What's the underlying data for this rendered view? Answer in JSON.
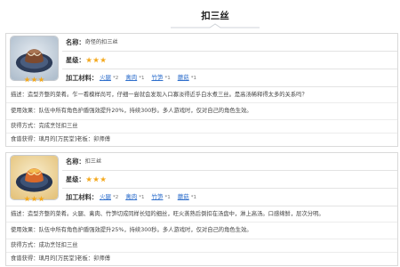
{
  "page": {
    "title": "扣三丝"
  },
  "colors": {
    "link": "#2f6fcc",
    "star": "#f4a81c",
    "text": "#3a3a3a",
    "border": "#dadada"
  },
  "cards": [
    {
      "icon": {
        "name": "dish-icon",
        "bg_light": "#e6ecf2",
        "bg_dark": "#aebdcc",
        "plate": "#2d3c58",
        "plate_inner": "#4a5d7e",
        "food": "#7e4a2e",
        "food_top": "#a87452",
        "topping": "#eee0c6"
      },
      "name_label": "名称：",
      "name": "奇怪的扣三丝",
      "star_label": "星级：",
      "stars": 3,
      "materials_label": "加工材料：",
      "materials": [
        {
          "name": "火腿",
          "count": "*2"
        },
        {
          "name": "禽肉",
          "count": "*1"
        },
        {
          "name": "竹笋",
          "count": "*1"
        },
        {
          "name": "蘑菇",
          "count": "*1"
        }
      ],
      "description_label": "描述：",
      "description": "造型齐整的菜肴。乍一看模样尚可，仔细一尝就会发现入口寡淡得近乎白水煮三丝。是高汤稀释得太多的关系吗？",
      "effect_label": "使用效果：",
      "effect": "队伍中所有角色护盾强效提升20%，持续300秒。多人游戏时，仅对自己的角色生效。",
      "obtain_label": "获得方式：",
      "obtain": "完成烹饪扣三丝",
      "recipe_label": "食谱获得：",
      "recipe": "璃月的[万民堂]老板：卯师傅"
    },
    {
      "icon": {
        "name": "dish-icon",
        "bg_light": "#f8eccb",
        "bg_dark": "#e4c27a",
        "plate": "#263552",
        "plate_inner": "#3d5275",
        "food": "#d9692a",
        "food_top": "#f2b94e",
        "topping": "#fbe6a6"
      },
      "name_label": "名称：",
      "name": "扣三丝",
      "star_label": "星级：",
      "stars": 3,
      "materials_label": "加工材料：",
      "materials": [
        {
          "name": "火腿",
          "count": "*2"
        },
        {
          "name": "禽肉",
          "count": "*1"
        },
        {
          "name": "竹笋",
          "count": "*1"
        },
        {
          "name": "蘑菇",
          "count": "*1"
        }
      ],
      "description_label": "描述：",
      "description": "造型齐整的菜肴。火腿、禽肉、竹笋切成同样长短的细丝，旺火蒸熟后倒扣在汤盘中，淋上高汤。口感绵鲜，层次分明。",
      "effect_label": "使用效果：",
      "effect": "队伍中所有角色护盾强效提升25%，持续300秒。多人游戏时，仅对自己的角色生效。",
      "obtain_label": "获得方式：",
      "obtain": "成功烹饪扣三丝",
      "recipe_label": "食谱获得：",
      "recipe": "璃月的[万民堂]老板：卯师傅"
    }
  ]
}
